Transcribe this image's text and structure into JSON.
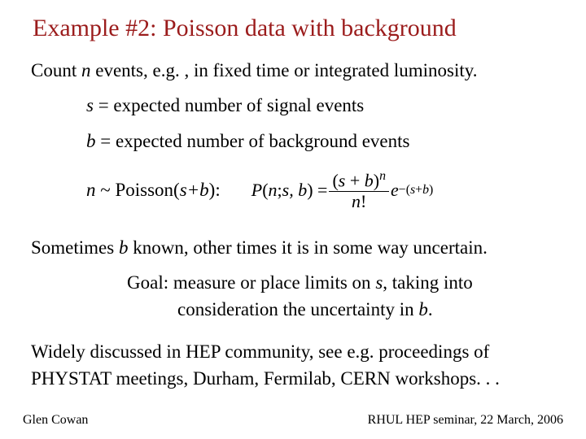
{
  "title": "Example #2:  Poisson data with background",
  "body": {
    "count_prefix": "Count ",
    "count_var": "n",
    "count_suffix": " events, e.g. , in fixed time or integrated luminosity.",
    "s_var": "s",
    "s_def": " = expected number of signal events",
    "b_var": "b",
    "b_def": " = expected number of background events",
    "dist_var": "n",
    "dist_text_mid": " ~ Poisson(",
    "dist_text_arg": "s+b",
    "dist_text_end": "):",
    "formula_lhs1": "P",
    "formula_lhs2": "(",
    "formula_lhs3": "n",
    "formula_lhs4": "; ",
    "formula_lhs5": "s, b",
    "formula_lhs6": ") = ",
    "formula_num1": "(",
    "formula_num2": "s",
    "formula_num3": " + ",
    "formula_num4": "b",
    "formula_num5": ")",
    "formula_num_exp": "n",
    "formula_den1": "n",
    "formula_den2": "!",
    "formula_exp1": "e",
    "formula_exp2": "−(",
    "formula_exp3": "s",
    "formula_exp4": "+",
    "formula_exp5": "b",
    "formula_exp6": ")",
    "sometimes_pre": "Sometimes ",
    "sometimes_b": "b",
    "sometimes_post": " known, other times it is in some way uncertain.",
    "goal_label": "Goal:   ",
    "goal_l1a": "measure or place limits on ",
    "goal_l1_s": "s",
    "goal_l1b": ", taking into",
    "goal_l2a": "consideration the uncertainty in ",
    "goal_l2_b": "b",
    "goal_l2b": ".",
    "widely1": "Widely discussed in HEP community, see e.g. proceedings of",
    "widely2": "PHYSTAT meetings, Durham, Fermilab, CERN workshops. . ."
  },
  "footer": {
    "left": "Glen Cowan",
    "right": "RHUL HEP seminar, 22 March, 2006"
  }
}
